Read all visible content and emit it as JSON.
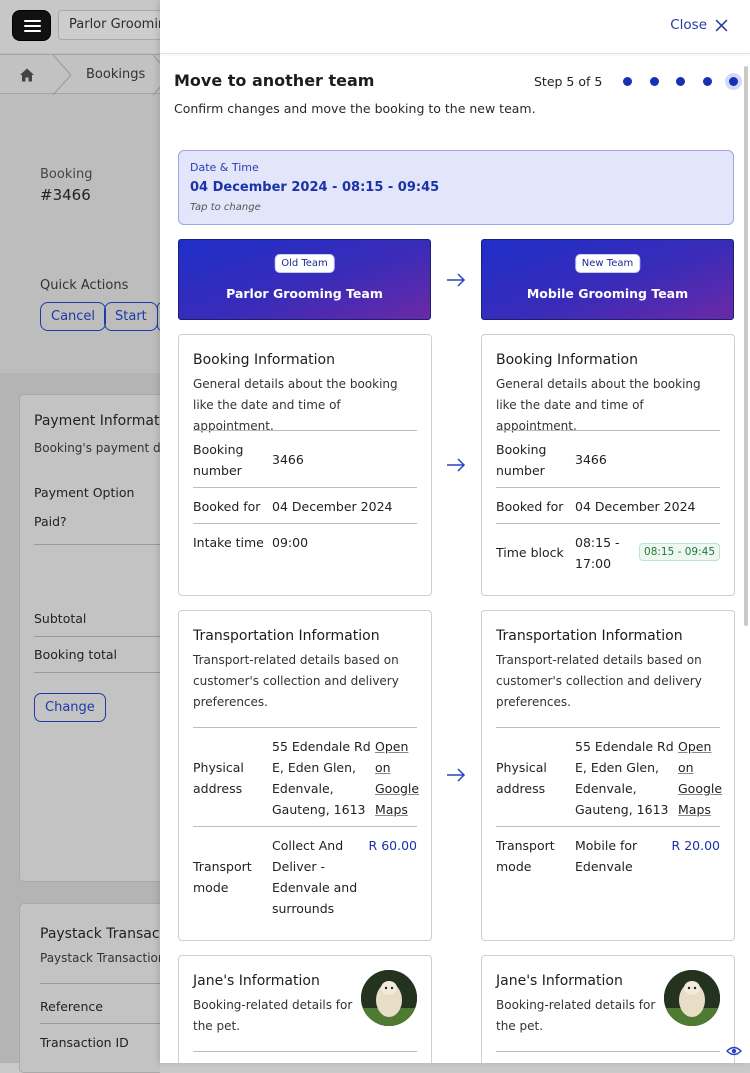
{
  "background": {
    "select_value": "Parlor Grooming",
    "breadcrumb": "Bookings",
    "booking_label": "Booking",
    "booking_number": "#3466",
    "quick_actions_label": "Quick Actions",
    "actions": [
      "Cancel",
      "Start"
    ],
    "payment_card": {
      "title": "Payment Informatio",
      "subtitle": "Booking's payment det",
      "payment_option": "Payment Option",
      "paid": "Paid?",
      "subtotal": "Subtotal",
      "booking_total": "Booking total",
      "change": "Change"
    },
    "paystack_card": {
      "title": "Paystack Transactio",
      "subtitle": "Paystack Transaction",
      "reference": "Reference",
      "transaction_id": "Transaction ID"
    }
  },
  "modal": {
    "close_label": "Close",
    "title": "Move to another team",
    "step_text": "Step 5 of 5",
    "subtitle": "Confirm changes and move the booking to the new team.",
    "date_time": {
      "label": "Date & Time",
      "value": "04 December 2024 - 08:15 - 09:45",
      "hint": "Tap to change"
    },
    "old_team": {
      "badge": "Old Team",
      "name": "Parlor Grooming Team"
    },
    "new_team": {
      "badge": "New Team",
      "name": "Mobile Grooming Team"
    },
    "booking_info": {
      "title": "Booking Information",
      "desc": "General details about the booking like the date and time of appointment.",
      "number_label": "Booking number",
      "number_value": "3466",
      "booked_for_label": "Booked for",
      "booked_for_value": "04 December 2024",
      "old_time_label": "Intake time",
      "old_time_value": "09:00",
      "new_time_label": "Time block",
      "new_time_value": "08:15 - 17:00",
      "new_time_tag": "08:15 - 09:45"
    },
    "transport_info": {
      "title": "Transportation Information",
      "desc": "Transport-related details based on customer's collection and delivery preferences.",
      "address_label": "Physical address",
      "address_value": "55 Edendale Rd E, Eden Glen, Edenvale, Gauteng, 1613",
      "maps_link": "Open on Google Maps",
      "mode_label": "Transport mode",
      "old_mode_value": "Collect And Deliver - Edenvale and surrounds",
      "old_mode_price": "R 60.00",
      "new_mode_value": "Mobile for Edenvale",
      "new_mode_price": "R 20.00"
    },
    "pet_info": {
      "title": "Jane's Information",
      "desc": "Booking-related details for the pet."
    }
  }
}
